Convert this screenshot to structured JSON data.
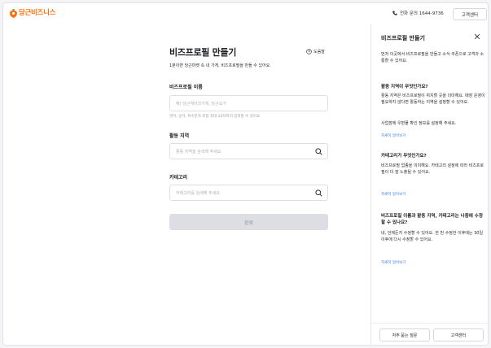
{
  "header": {
    "logo_text": "당근비즈니스",
    "phone_text": "전화 문의 1644-9736",
    "cs_button": "고객센터"
  },
  "form": {
    "title": "비즈프로필 만들기",
    "help_label": "도움말",
    "subtitle": "1분이면 당근마켓 속 내 가게, 비즈프로필을 만들 수 있어요.",
    "name_label": "비즈프로필 이름",
    "name_placeholder": "예) 당근케이크가게, 당근요가",
    "name_hint": "영어, 숫자, 특수문자 포함 최대 24자까지 입력할 수 있어요.",
    "region_label": "활동 지역",
    "region_placeholder": "활동 지역을 검색해 주세요.",
    "category_label": "카테고리",
    "category_placeholder": "카테고리를 검색해 주세요.",
    "submit_label": "완료"
  },
  "panel": {
    "title": "비즈프로필 만들기",
    "intro": "먼저 이곳에서 비즈프로필을 만들고 소식·쿠폰으로 고객과 소통할 수 있어요.",
    "sections": [
      {
        "question": "활동 지역이 무엇인가요?",
        "answer": "활동 지역은 비즈프로필이 위치할 곳을 의미해요. 매장 운영이 필요하지 않다면 활동하는 지역을 설정할 수 있어요.",
        "extra": "사업장에 우편물 확인 정보를 설정해 주세요.",
        "link": "자세히 알아보기"
      },
      {
        "question": "카테고리가 무엇인가요?",
        "answer": "비즈프로필 업종을 의미해요. 카테고리 설정에 따라 비즈프로필이 더 잘 노출될 수 있어요.",
        "link": "자세히 알아보기"
      },
      {
        "question": "비즈프로필 이름과 활동 지역, 카테고리는 나중에 수정할 수 있나요?",
        "answer": "네, 언제든지 수정할 수 있어요. 한 번 수정한 이후에는 30일 이후에 다시 수정할 수 있어요.",
        "link": "자세히 알아보기"
      }
    ],
    "faq_button": "자주 묻는 질문",
    "cs_button": "고객센터"
  }
}
